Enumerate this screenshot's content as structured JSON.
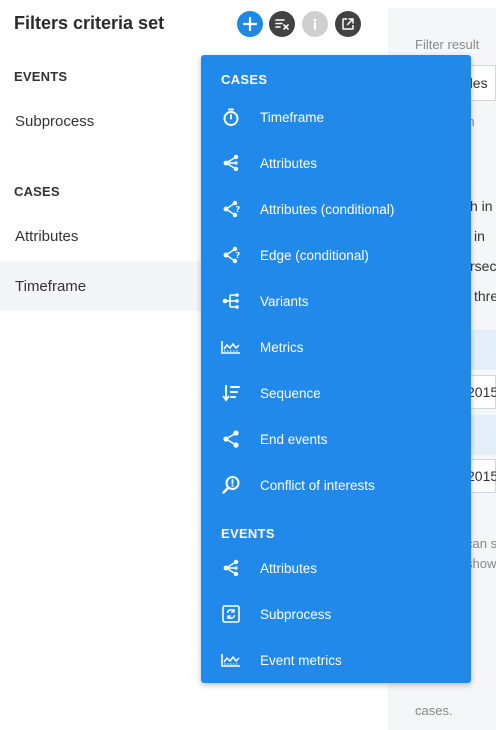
{
  "panel": {
    "title": "Filters criteria set",
    "sections": [
      {
        "header": "EVENTS",
        "items": [
          "Subprocess"
        ]
      },
      {
        "header": "CASES",
        "items": [
          "Attributes",
          "Timeframe"
        ]
      }
    ],
    "selected_item": "Timeframe"
  },
  "toolbar": {
    "add_icon": "plus-circle-icon",
    "clear_icon": "clear-filter-icon",
    "info_icon": "info-icon",
    "export_icon": "export-icon"
  },
  "right_panel": {
    "filter_result_label": "Filter result",
    "field1_value": "des",
    "hint_text": "ich",
    "lines": [
      "h in",
      "in",
      "rsect",
      "thre"
    ],
    "date1": "2015",
    "date2": "2015",
    "note1": "can s",
    "note2": "show",
    "footer": "cases."
  },
  "menu": {
    "cases_header": "CASES",
    "cases_items": [
      {
        "label": "Timeframe",
        "icon": "stopwatch-icon"
      },
      {
        "label": "Attributes",
        "icon": "attributes-icon"
      },
      {
        "label": "Attributes (conditional)",
        "icon": "attributes-conditional-icon"
      },
      {
        "label": "Edge (conditional)",
        "icon": "edge-conditional-icon"
      },
      {
        "label": "Variants",
        "icon": "variants-icon"
      },
      {
        "label": "Metrics",
        "icon": "metrics-icon"
      },
      {
        "label": "Sequence",
        "icon": "sequence-icon"
      },
      {
        "label": "End events",
        "icon": "end-events-icon"
      },
      {
        "label": "Conflict of interests",
        "icon": "conflict-search-icon"
      }
    ],
    "events_header": "EVENTS",
    "events_items": [
      {
        "label": "Attributes",
        "icon": "attributes-icon"
      },
      {
        "label": "Subprocess",
        "icon": "subprocess-icon"
      },
      {
        "label": "Event metrics",
        "icon": "metrics-icon"
      }
    ]
  },
  "colors": {
    "menu_bg": "#2089ea",
    "accent": "#1e88e5",
    "selected_bg": "#f3f6f9"
  }
}
